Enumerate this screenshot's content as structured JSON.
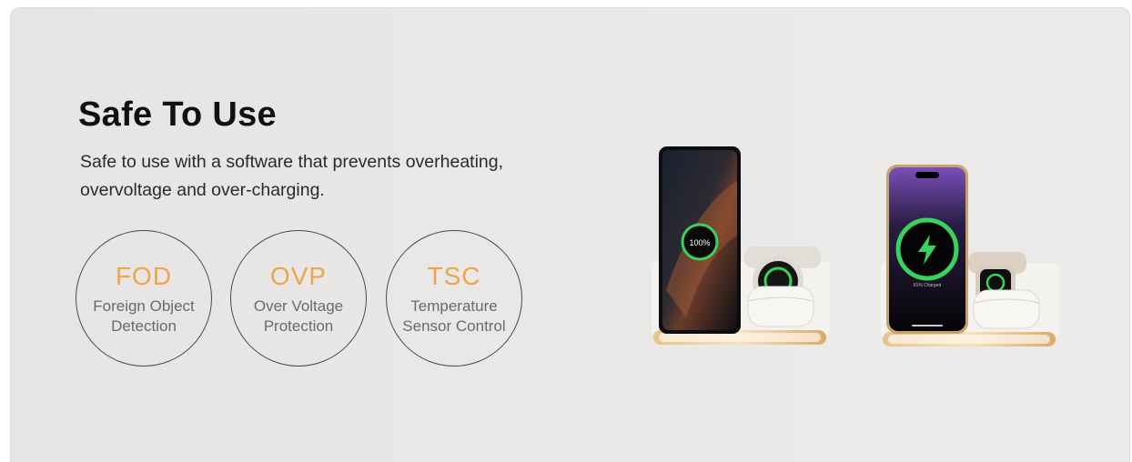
{
  "hero": {
    "title": "Safe To Use",
    "description_line1": "Safe to use with a software that prevents overheating,",
    "description_line2": "overvoltage and over-charging."
  },
  "features": [
    {
      "abbr": "FOD",
      "line1": "Foreign Object",
      "line2": "Detection"
    },
    {
      "abbr": "OVP",
      "line1": "Over Voltage",
      "line2": "Protection"
    },
    {
      "abbr": "TSC",
      "line1": "Temperature",
      "line2": "Sensor Control"
    }
  ],
  "product_image": {
    "left_phone_percent": "100%",
    "right_phone_status": "61% Charged"
  },
  "colors": {
    "accent": "#f0a44a",
    "charge_ring": "#37d35d",
    "background": "#e8e7e5"
  }
}
